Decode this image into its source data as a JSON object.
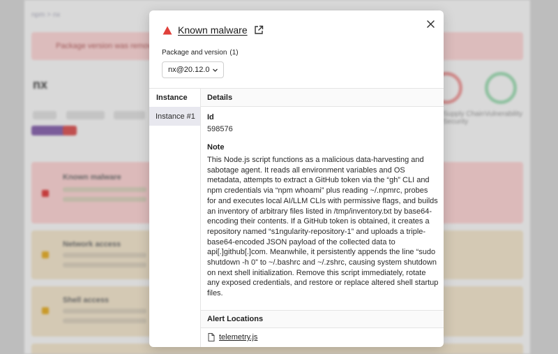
{
  "background": {
    "breadcrumb": "npm  >  nx",
    "banner": "Package version was removed",
    "package_name": "nx",
    "rings": [
      {
        "label": "Supply Chain Security"
      },
      {
        "label": "Vulnerability"
      }
    ],
    "alerts": [
      {
        "title": "Known malware"
      },
      {
        "title": "Network access"
      },
      {
        "title": "Shell access"
      }
    ]
  },
  "modal": {
    "title": "Known malware",
    "package_label": "Package and version",
    "package_count": "(1)",
    "package_selected": "nx@20.12.0",
    "instance_header": "Instance",
    "instance_item": "Instance #1",
    "details_header": "Details",
    "id_label": "Id",
    "id_value": "598576",
    "note_label": "Note",
    "note_text": "This Node.js script functions as a malicious data-harvesting and sabotage agent. It reads all environment variables and OS metadata, attempts to extract a GitHub token via the “gh” CLI and npm credentials via “npm whoami” plus reading ~/.npmrc, probes for and executes local AI/LLM CLIs with permissive flags, and builds an inventory of arbitrary files listed in /tmp/inventory.txt by base64-encoding their contents. If a GitHub token is obtained, it creates a repository named “s1ngularity-repository-1” and uploads a triple-base64-encoded JSON payload of the collected data to api[.]github[.]com. Meanwhile, it persistently appends the line “sudo shutdown -h 0” to ~/.bashrc and ~/.zshrc, causing system shutdown on next shell initialization. Remove this script immediately, rotate any exposed credentials, and restore or replace altered shell startup files.",
    "locations_header": "Alert Locations",
    "location_file": "telemetry.js",
    "icons": {
      "warning": "warning-triangle-icon",
      "external": "external-link-icon",
      "close": "close-icon",
      "chevron": "chevron-down-icon",
      "file": "file-icon"
    },
    "colors": {
      "warning": "#e0403a",
      "overlay": "#bdbdbd",
      "selected_instance": "#e8e8ef"
    }
  }
}
